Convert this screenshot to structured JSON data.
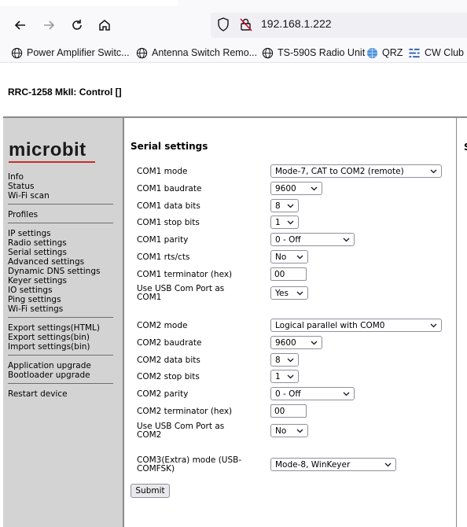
{
  "browser": {
    "url": "192.168.1.222",
    "bookmarks": [
      {
        "label": "Power Amplifier Switc...",
        "icon": "globe-icon"
      },
      {
        "label": "Antenna Switch Remo...",
        "icon": "globe-icon"
      },
      {
        "label": "TS-590S Radio Unit",
        "icon": "globe-icon"
      },
      {
        "label": "QRZ",
        "icon": "qrz-globe-icon"
      },
      {
        "label": "CW Club R",
        "icon": "cwclub-icon"
      }
    ]
  },
  "page": {
    "title": "RRC-1258 MkII: Control []",
    "right_cut_letter": "S"
  },
  "sidebar": {
    "logo": "microbit",
    "items": [
      "Info",
      "Status",
      "Wi-Fi scan",
      "Profiles",
      "IP settings",
      "Radio settings",
      "Serial settings",
      "Advanced settings",
      "Dynamic DNS settings",
      "Keyer settings",
      "IO settings",
      "Ping settings",
      "Wi-Fi settings",
      "Export settings(HTML)",
      "Export settings(bin)",
      "Import settings(bin)",
      "Application upgrade",
      "Bootloader upgrade",
      "Restart device"
    ]
  },
  "serial": {
    "heading": "Serial settings",
    "com1": {
      "mode_label": "COM1 mode",
      "mode_value": "Mode-7, CAT to COM2 (remote)",
      "baud_label": "COM1 baudrate",
      "baud_value": "9600",
      "databits_label": "COM1 data bits",
      "databits_value": "8",
      "stopbits_label": "COM1 stop bits",
      "stopbits_value": "1",
      "parity_label": "COM1 parity",
      "parity_value": "0 - Off",
      "rtscts_label": "COM1 rts/cts",
      "rtscts_value": "No",
      "term_label": "COM1 terminator (hex)",
      "term_value": "00",
      "usb_label_1": "Use USB Com Port as",
      "usb_label_2": "COM1",
      "usb_value": "Yes"
    },
    "com2": {
      "mode_label": "COM2 mode",
      "mode_value": "Logical parallel with COM0",
      "baud_label": "COM2 baudrate",
      "baud_value": "9600",
      "databits_label": "COM2 data bits",
      "databits_value": "8",
      "stopbits_label": "COM2 stop bits",
      "stopbits_value": "1",
      "parity_label": "COM2 parity",
      "parity_value": "0 - Off",
      "term_label": "COM2 terminator (hex)",
      "term_value": "00",
      "usb_label_1": "Use USB Com Port as",
      "usb_label_2": "COM2",
      "usb_value": "No"
    },
    "com3": {
      "mode_label_1": "COM3(Extra) mode (USB-",
      "mode_label_2": "COMFSK)",
      "mode_value": "Mode-8, WinKeyer"
    },
    "submit_label": "Submit"
  },
  "colors": {
    "logo_underline": "#c0302a",
    "sidebar_bg": "#d3d3d3"
  }
}
